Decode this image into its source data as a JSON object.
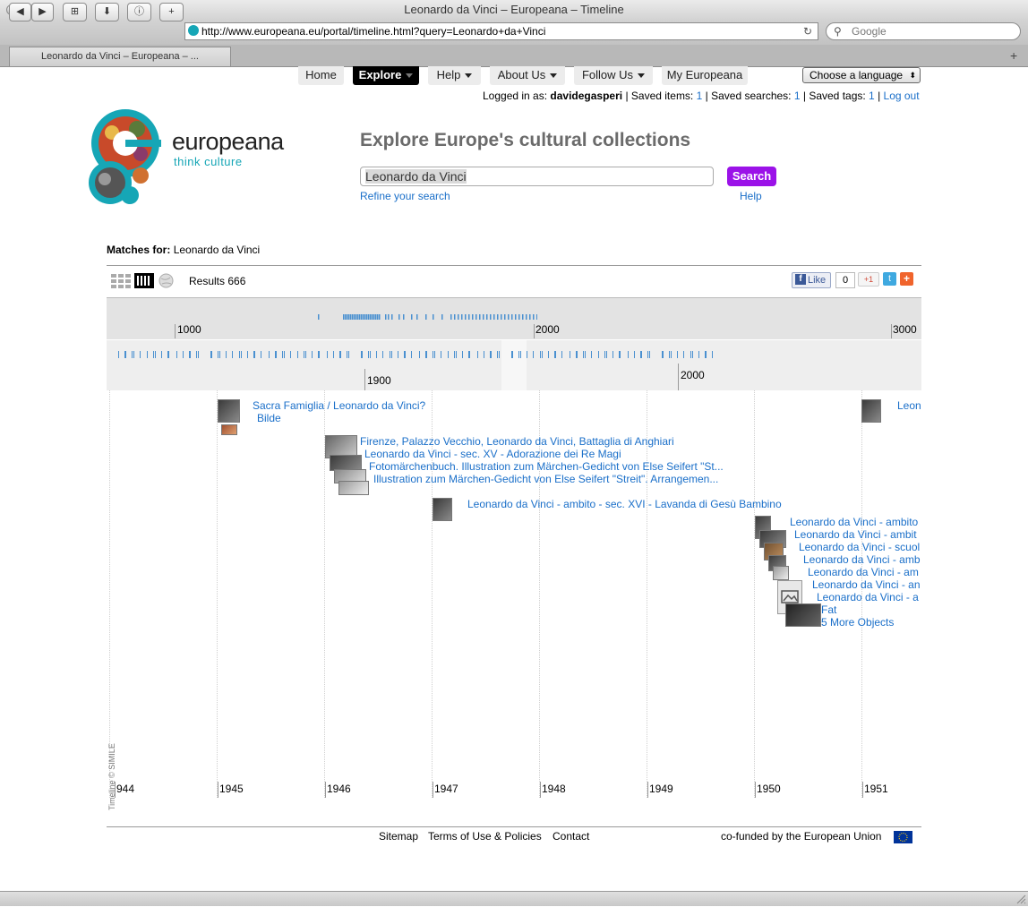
{
  "browser": {
    "window_title": "Leonardo da Vinci – Europeana – Timeline",
    "url": "http://www.europeana.eu/portal/timeline.html?query=Leonardo+da+Vinci",
    "search_placeholder": "Google",
    "tab_title": "Leonardo da Vinci – Europeana – ..."
  },
  "nav": {
    "items": [
      "Home",
      "Explore",
      "Help",
      "About Us",
      "Follow Us",
      "My Europeana"
    ],
    "active": "Explore",
    "language_label": "Choose a language"
  },
  "login": {
    "logged_in_label": "Logged in as:",
    "username": "davidegasperi",
    "saved_items_label": "Saved items:",
    "saved_items": "1",
    "saved_searches_label": "Saved searches:",
    "saved_searches": "1",
    "saved_tags_label": "Saved tags:",
    "saved_tags": "1",
    "logout": "Log out"
  },
  "brand": {
    "name": "europeana",
    "tagline": "think culture",
    "accent": "#16a6b6"
  },
  "search": {
    "headline": "Explore Europe's cultural collections",
    "query": "Leonardo da Vinci",
    "button": "Search",
    "refine": "Refine your search",
    "help": "Help",
    "button_color": "#9b12e8"
  },
  "results": {
    "matches_label": "Matches for:",
    "matches_query": "Leonardo da Vinci",
    "count_text": "Results 666",
    "like_label": "Like",
    "like_count": "0",
    "gplus": "+1"
  },
  "timeline": {
    "overview_labels": [
      "1000",
      "2000",
      "3000"
    ],
    "detail_labels": [
      "1900",
      "2000"
    ],
    "year_labels": [
      "944",
      "1945",
      "1946",
      "1947",
      "1948",
      "1949",
      "1950",
      "1951"
    ],
    "credit": "Timeline © SIMILE",
    "events": [
      "Sacra Famiglia / Leonardo da Vinci?",
      "Bilde",
      "Leon",
      "Firenze, Palazzo Vecchio, Leonardo da Vinci, Battaglia di Anghiari",
      "Leonardo da Vinci - sec. XV - Adorazione dei Re Magi",
      "Fotomärchenbuch. Illustration zum Märchen-Gedicht von Else Seifert \"St...",
      "Illustration zum Märchen-Gedicht von Else Seifert \"Streit\". Arrangemen...",
      "Leonardo da Vinci - ambito - sec. XVI - Lavanda di Gesù Bambino",
      "Leonardo da Vinci - ambito",
      "Leonardo da Vinci - ambit",
      "Leonardo da Vinci - scuol",
      "Leonardo da Vinci - amb",
      "Leonardo da Vinci - am",
      "Leonardo da Vinci - an",
      "Leonardo da Vinci - a",
      "Fat",
      "5 More Objects"
    ]
  },
  "footer": {
    "links": [
      "Sitemap",
      "Terms of Use & Policies",
      "Contact"
    ],
    "cofunded": "co-funded by the European Union"
  }
}
